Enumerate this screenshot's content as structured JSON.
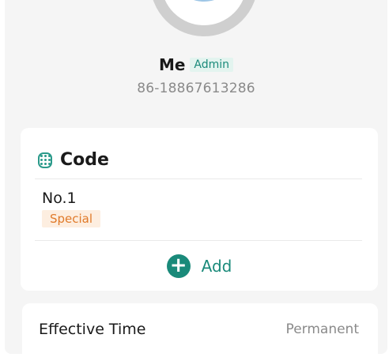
{
  "profile": {
    "name": "Me",
    "role": "Admin",
    "phone": "86-18867613286"
  },
  "code_section": {
    "title": "Code",
    "icon": "keypad-icon",
    "items": [
      {
        "name": "No.1",
        "type": "Special"
      }
    ],
    "add_label": "Add"
  },
  "effective_time": {
    "label": "Effective Time",
    "value": "Permanent"
  },
  "colors": {
    "accent": "#1a8a7a",
    "special": "#e07a2a",
    "background": "#f5f5f5"
  }
}
